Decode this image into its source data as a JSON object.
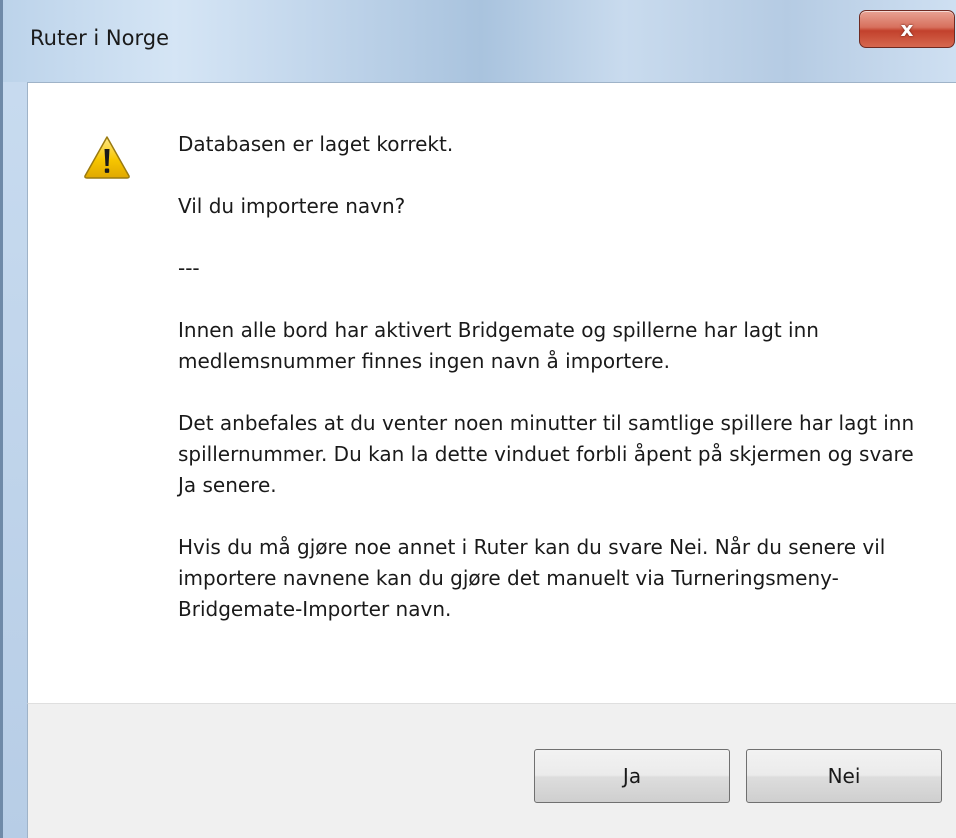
{
  "window": {
    "title": "Ruter i Norge",
    "close_label": "x"
  },
  "icon": "warning-icon",
  "message": {
    "lines": [
      "Databasen er laget korrekt.",
      "Vil du importere navn?",
      "---",
      "Innen alle bord har aktivert Bridgemate og spillerne har lagt inn medlemsnummer finnes ingen navn å importere.",
      "Det anbefales at du venter noen minutter til samtlige spillere har lagt inn spillernummer. Du kan la dette vinduet forbli åpent på skjermen og svare Ja senere.",
      "Hvis du må gjøre noe annet i Ruter kan du svare Nei. Når du senere vil importere navnene kan du gjøre det manuelt via Turneringsmeny-Bridgemate-Importer navn."
    ]
  },
  "buttons": {
    "yes_label": "Ja",
    "no_label": "Nei"
  },
  "colors": {
    "warning_yellow": "#f7c600",
    "close_red": "#c2412c"
  }
}
